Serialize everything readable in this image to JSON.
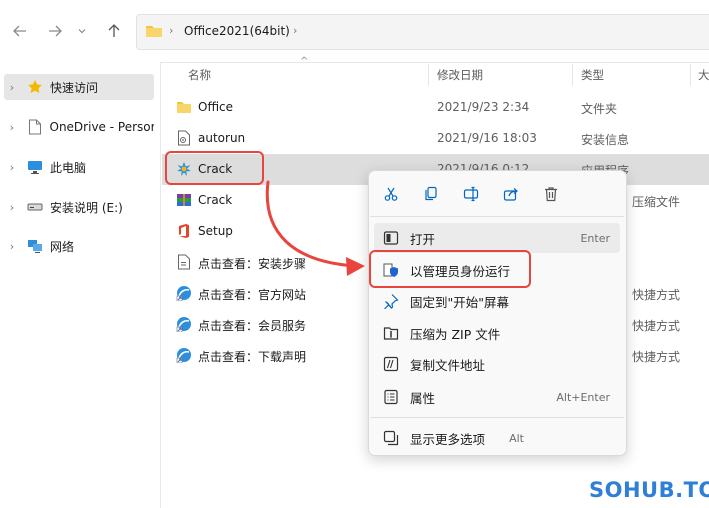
{
  "address": {
    "path": "Office2021(64bit)"
  },
  "sidebar": {
    "items": [
      {
        "label": "快速访问",
        "icon": "star-icon"
      },
      {
        "label": "OneDrive - Persor",
        "icon": "file-icon"
      },
      {
        "label": "此电脑",
        "icon": "computer-icon"
      },
      {
        "label": "安装说明 (E:)",
        "icon": "drive-icon"
      },
      {
        "label": "网络",
        "icon": "network-icon"
      }
    ]
  },
  "columns": {
    "name": "名称",
    "date": "修改日期",
    "type": "类型",
    "size": "大"
  },
  "files": [
    {
      "name": "Office",
      "date": "2021/9/23 2:34",
      "type": "文件夹",
      "extra": "",
      "icon": "folder-icon"
    },
    {
      "name": "autorun",
      "date": "2021/9/16 18:03",
      "type": "安装信息",
      "extra": "",
      "icon": "setup-info-icon"
    },
    {
      "name": "Crack",
      "date": "2021/9/16 0:12",
      "type": "应用程序",
      "extra": "",
      "icon": "app-icon"
    },
    {
      "name": "Crack",
      "date": "",
      "type": "",
      "extra": "压缩文件",
      "icon": "archive-icon"
    },
    {
      "name": "Setup",
      "date": "",
      "type": "",
      "extra": "",
      "icon": "office-icon"
    },
    {
      "name": "点击查看：安装步骤",
      "date": "",
      "type": "",
      "extra": "",
      "icon": "document-icon"
    },
    {
      "name": "点击查看：官方网站",
      "date": "",
      "type": "",
      "extra": "快捷方式",
      "icon": "shortcut-icon"
    },
    {
      "name": "点击查看：会员服务",
      "date": "",
      "type": "",
      "extra": "快捷方式",
      "icon": "shortcut-icon"
    },
    {
      "name": "点击查看：下载声明",
      "date": "",
      "type": "",
      "extra": "快捷方式",
      "icon": "shortcut-icon"
    }
  ],
  "menu": {
    "toolbar": [
      "cut-icon",
      "copy-icon",
      "rename-icon",
      "share-icon",
      "delete-icon"
    ],
    "items": [
      {
        "label": "打开",
        "shortcut": "Enter",
        "icon": "open-icon"
      },
      {
        "label": "以管理员身份运行",
        "shortcut": "",
        "icon": "shield-icon"
      },
      {
        "label": "固定到\"开始\"屏幕",
        "shortcut": "",
        "icon": "pin-icon"
      },
      {
        "label": "压缩为 ZIP 文件",
        "shortcut": "",
        "icon": "zip-icon"
      },
      {
        "label": "复制文件地址",
        "shortcut": "",
        "icon": "copy-path-icon"
      },
      {
        "label": "属性",
        "shortcut": "Alt+Enter",
        "icon": "properties-icon"
      },
      {
        "label": "显示更多选项",
        "shortcut": "Alt",
        "icon": "more-options-icon"
      }
    ]
  },
  "watermark": "SOHUB.TOP",
  "colors": {
    "highlight": "#e8453c",
    "accent": "#0067c0",
    "folder": "#f5c343"
  }
}
